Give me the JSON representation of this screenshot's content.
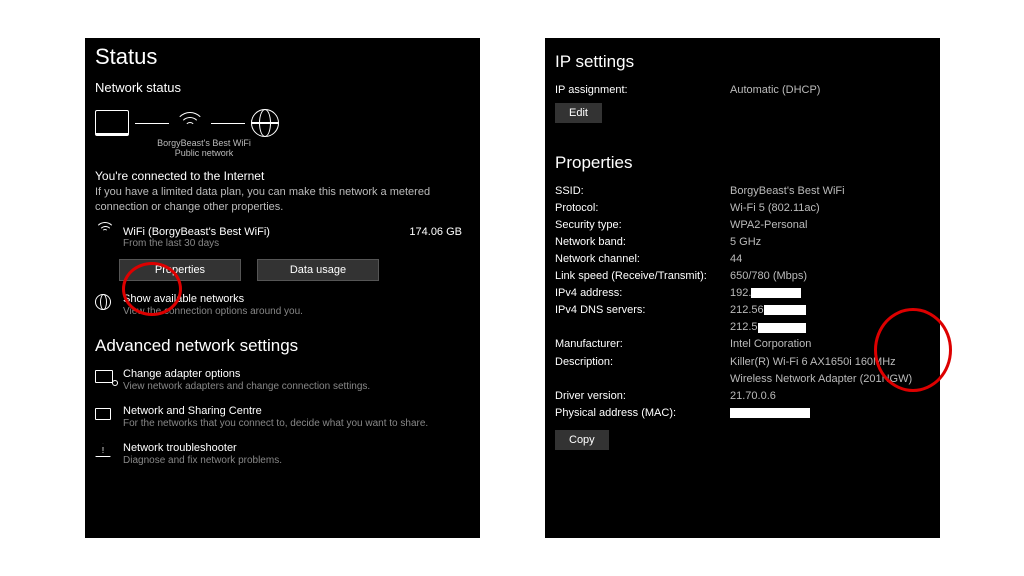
{
  "left": {
    "title": "Status",
    "section": "Network status",
    "diagram_label1": "BorgyBeast's Best WiFi",
    "diagram_label2": "Public network",
    "connected_heading": "You're connected to the Internet",
    "connected_desc": "If you have a limited data plan, you can make this network a metered connection or change other properties.",
    "conn_name": "WiFi (BorgyBeast's Best WiFi)",
    "conn_sub": "From the last 30 days",
    "conn_usage": "174.06 GB",
    "btn_properties": "Properties",
    "btn_datausage": "Data usage",
    "avail_title": "Show available networks",
    "avail_desc": "View the connection options around you.",
    "adv_heading": "Advanced network settings",
    "adapter_title": "Change adapter options",
    "adapter_desc": "View network adapters and change connection settings.",
    "sharing_title": "Network and Sharing Centre",
    "sharing_desc": "For the networks that you connect to, decide what you want to share.",
    "trouble_title": "Network troubleshooter",
    "trouble_desc": "Diagnose and fix network problems."
  },
  "right": {
    "ip_heading": "IP settings",
    "ip_assign_k": "IP assignment:",
    "ip_assign_v": "Automatic (DHCP)",
    "btn_edit": "Edit",
    "props_heading": "Properties",
    "rows": {
      "ssid_k": "SSID:",
      "ssid_v": "BorgyBeast's Best WiFi",
      "proto_k": "Protocol:",
      "proto_v": "Wi-Fi 5 (802.11ac)",
      "sec_k": "Security type:",
      "sec_v": "WPA2-Personal",
      "band_k": "Network band:",
      "band_v": "5 GHz",
      "chan_k": "Network channel:",
      "chan_v": "44",
      "link_k": "Link speed (Receive/Transmit):",
      "link_v": "650/780 (Mbps)",
      "ip4_k": "IPv4 address:",
      "ip4_v": "192.",
      "dns_k": "IPv4 DNS servers:",
      "dns_v1": "212.56",
      "dns_v2": "212.5",
      "manu_k": "Manufacturer:",
      "manu_v": "Intel Corporation",
      "descr_k": "Description:",
      "descr_v": "Killer(R) Wi-Fi 6 AX1650i 160MHz Wireless Network Adapter (201NGW)",
      "drv_k": "Driver version:",
      "drv_v": "21.70.0.6",
      "mac_k": "Physical address (MAC):"
    },
    "btn_copy": "Copy"
  }
}
